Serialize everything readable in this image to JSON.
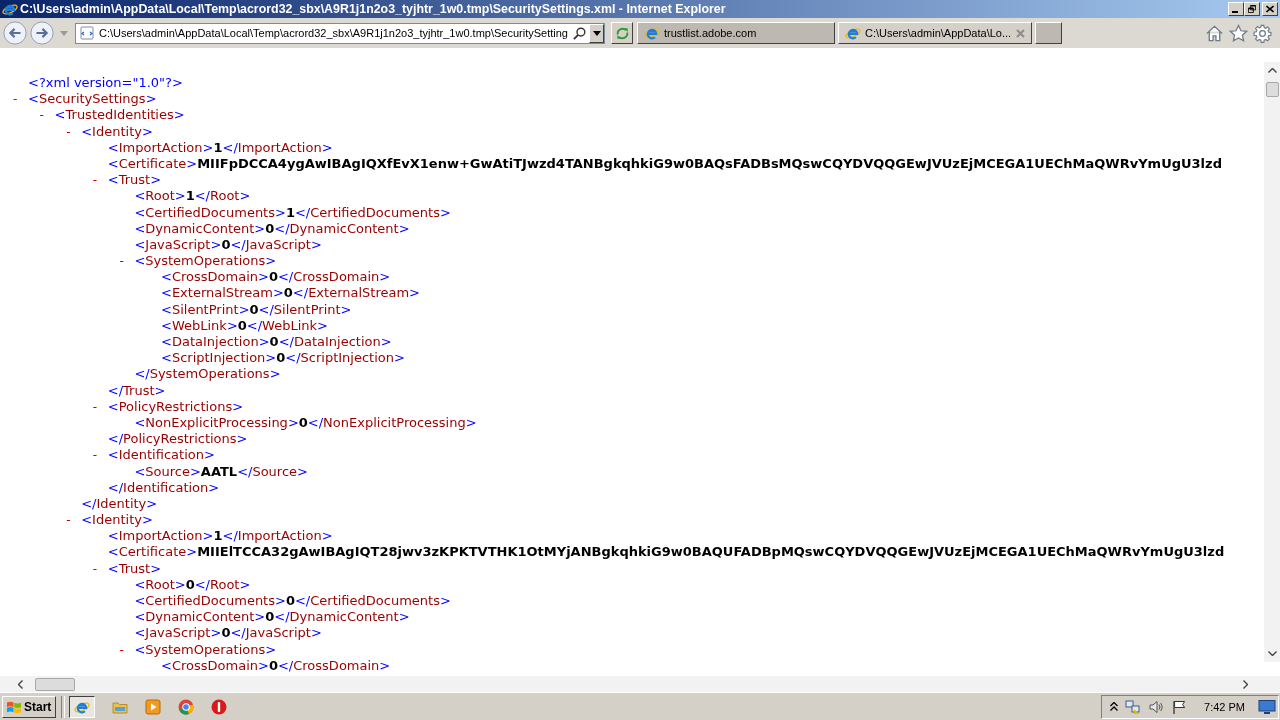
{
  "window": {
    "title": "C:\\Users\\admin\\AppData\\Local\\Temp\\acrord32_sbx\\A9R1j1n2o3_tyjhtr_1w0.tmp\\SecuritySettings.xml - Internet Explorer"
  },
  "toolbar": {
    "address": "C:\\Users\\admin\\AppData\\Local\\Temp\\acrord32_sbx\\A9R1j1n2o3_tyjhtr_1w0.tmp\\SecuritySetting",
    "tabs": [
      {
        "label": "trustlist.adobe.com",
        "selected": false
      },
      {
        "label": "C:\\Users\\admin\\AppData\\Lo...",
        "selected": true
      }
    ]
  },
  "document": {
    "declaration": "<?xml version=\"1.0\"?>",
    "root": {
      "kind": "branch",
      "toggle": "-",
      "expanded": true,
      "open": "<SecuritySettings>",
      "children": [
        {
          "kind": "branch",
          "toggle": "-",
          "expanded": true,
          "open": "<TrustedIdentities>",
          "children": [
            {
              "kind": "branch",
              "toggle": "-",
              "expanded": true,
              "open": "<Identity>",
              "close": "</Identity>",
              "children": [
                {
                  "kind": "leaf",
                  "open": "<ImportAction>",
                  "value": "1",
                  "close": "</ImportAction>"
                },
                {
                  "kind": "leaf",
                  "open": "<Certificate>",
                  "value": "MIIFpDCCA4ygAwIBAgIQXfEvX1enw+GwAtiTJwzd4TANBgkqhkiG9w0BAQsFADBsMQswCQYDVQQGEwJVUzEjMCEGA1UEChMaQWRvYmUgU3lzd"
                },
                {
                  "kind": "branch",
                  "toggle": "-",
                  "expanded": true,
                  "open": "<Trust>",
                  "close": "</Trust>",
                  "children": [
                    {
                      "kind": "leaf",
                      "open": "<Root>",
                      "value": "1",
                      "close": "</Root>"
                    },
                    {
                      "kind": "leaf",
                      "open": "<CertifiedDocuments>",
                      "value": "1",
                      "close": "</CertifiedDocuments>"
                    },
                    {
                      "kind": "leaf",
                      "open": "<DynamicContent>",
                      "value": "0",
                      "close": "</DynamicContent>"
                    },
                    {
                      "kind": "leaf",
                      "open": "<JavaScript>",
                      "value": "0",
                      "close": "</JavaScript>"
                    },
                    {
                      "kind": "branch",
                      "toggle": "-",
                      "expanded": true,
                      "open": "<SystemOperations>",
                      "close": "</SystemOperations>",
                      "children": [
                        {
                          "kind": "leaf",
                          "open": "<CrossDomain>",
                          "value": "0",
                          "close": "</CrossDomain>"
                        },
                        {
                          "kind": "leaf",
                          "open": "<ExternalStream>",
                          "value": "0",
                          "close": "</ExternalStream>"
                        },
                        {
                          "kind": "leaf",
                          "open": "<SilentPrint>",
                          "value": "0",
                          "close": "</SilentPrint>"
                        },
                        {
                          "kind": "leaf",
                          "open": "<WebLink>",
                          "value": "0",
                          "close": "</WebLink>"
                        },
                        {
                          "kind": "leaf",
                          "open": "<DataInjection>",
                          "value": "0",
                          "close": "</DataInjection>"
                        },
                        {
                          "kind": "leaf",
                          "open": "<ScriptInjection>",
                          "value": "0",
                          "close": "</ScriptInjection>"
                        }
                      ]
                    }
                  ]
                },
                {
                  "kind": "branch",
                  "toggle": "-",
                  "expanded": true,
                  "open": "<PolicyRestrictions>",
                  "close": "</PolicyRestrictions>",
                  "children": [
                    {
                      "kind": "leaf",
                      "open": "<NonExplicitProcessing>",
                      "value": "0",
                      "close": "</NonExplicitProcessing>"
                    }
                  ]
                },
                {
                  "kind": "branch",
                  "toggle": "-",
                  "expanded": true,
                  "open": "<Identification>",
                  "close": "</Identification>",
                  "children": [
                    {
                      "kind": "leaf",
                      "open": "<Source>",
                      "value": "AATL",
                      "close": "</Source>"
                    }
                  ]
                }
              ]
            },
            {
              "kind": "branch",
              "toggle": "-",
              "expanded": true,
              "open": "<Identity>",
              "children": [
                {
                  "kind": "leaf",
                  "open": "<ImportAction>",
                  "value": "1",
                  "close": "</ImportAction>"
                },
                {
                  "kind": "leaf",
                  "open": "<Certificate>",
                  "value": "MIIElTCCA32gAwIBAgIQT28jwv3zKPKTVTHK1OtMYjANBgkqhkiG9w0BAQUFADBpMQswCQYDVQQGEwJVUzEjMCEGA1UEChMaQWRvYmUgU3lzd"
                },
                {
                  "kind": "branch",
                  "toggle": "-",
                  "expanded": true,
                  "open": "<Trust>",
                  "children": [
                    {
                      "kind": "leaf",
                      "open": "<Root>",
                      "value": "0",
                      "close": "</Root>"
                    },
                    {
                      "kind": "leaf",
                      "open": "<CertifiedDocuments>",
                      "value": "0",
                      "close": "</CertifiedDocuments>"
                    },
                    {
                      "kind": "leaf",
                      "open": "<DynamicContent>",
                      "value": "0",
                      "close": "</DynamicContent>"
                    },
                    {
                      "kind": "leaf",
                      "open": "<JavaScript>",
                      "value": "0",
                      "close": "</JavaScript>"
                    },
                    {
                      "kind": "branch",
                      "toggle": "-",
                      "expanded": true,
                      "open": "<SystemOperations>",
                      "children": [
                        {
                          "kind": "leaf",
                          "open": "<CrossDomain>",
                          "value": "0",
                          "close": "</CrossDomain>"
                        }
                      ]
                    }
                  ]
                }
              ]
            }
          ]
        }
      ]
    }
  },
  "taskbar": {
    "start": "Start",
    "clock": "7:42 PM"
  }
}
